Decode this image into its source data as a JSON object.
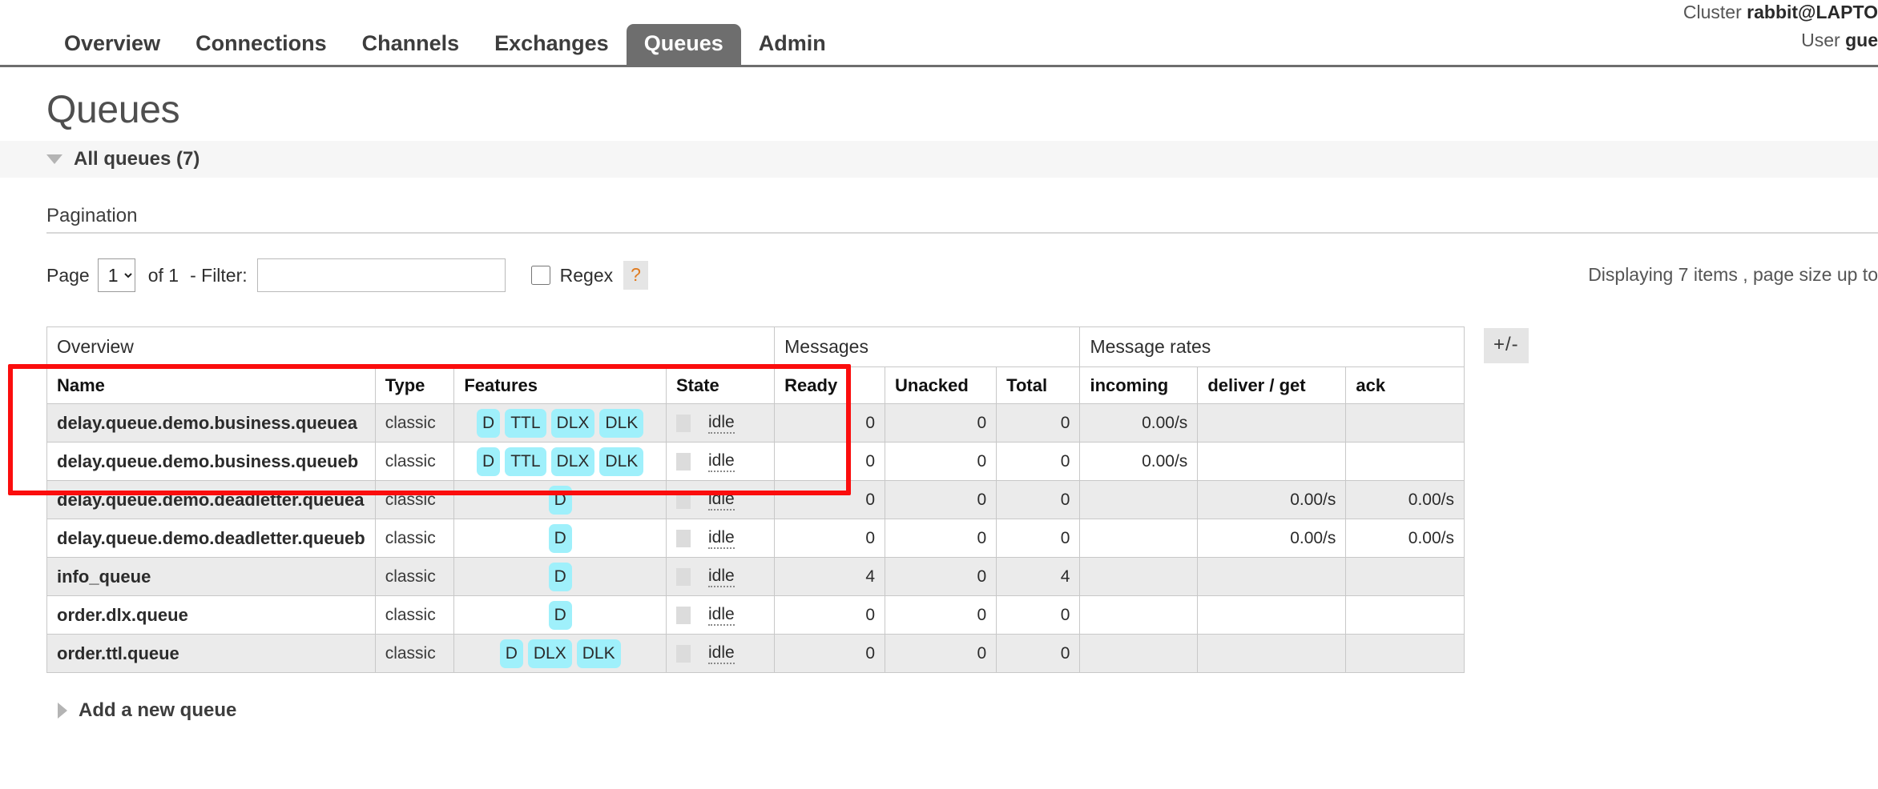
{
  "header": {
    "cluster_label": "Cluster",
    "cluster_name": "rabbit@LAPTO",
    "user_label": "User",
    "user_name": "gue",
    "nav": [
      {
        "label": "Overview",
        "active": false
      },
      {
        "label": "Connections",
        "active": false
      },
      {
        "label": "Channels",
        "active": false
      },
      {
        "label": "Exchanges",
        "active": false
      },
      {
        "label": "Queues",
        "active": true
      },
      {
        "label": "Admin",
        "active": false
      }
    ]
  },
  "page": {
    "title": "Queues",
    "section_label": "All queues (7)",
    "add_queue_label": "Add a new queue"
  },
  "pagination": {
    "heading": "Pagination",
    "page_word": "Page",
    "page_value": "1",
    "page_options": [
      "1"
    ],
    "of_text": "of 1",
    "filter_word": "- Filter:",
    "filter_value": "",
    "filter_placeholder": "",
    "regex_label": "Regex",
    "regex_checked": false,
    "help_badge": "?",
    "displaying_info": "Displaying 7 items , page size up to"
  },
  "table": {
    "group_headers": [
      {
        "label": "Overview",
        "span": 4
      },
      {
        "label": "Messages",
        "span": 3
      },
      {
        "label": "Message rates",
        "span": 3
      }
    ],
    "columns": [
      {
        "label": "Name",
        "key": "name"
      },
      {
        "label": "Type",
        "key": "type"
      },
      {
        "label": "Features",
        "key": "features"
      },
      {
        "label": "State",
        "key": "state"
      },
      {
        "label": "Ready",
        "key": "ready"
      },
      {
        "label": "Unacked",
        "key": "unacked"
      },
      {
        "label": "Total",
        "key": "total"
      },
      {
        "label": "incoming",
        "key": "incoming"
      },
      {
        "label": "deliver / get",
        "key": "deliver_get"
      },
      {
        "label": "ack",
        "key": "ack"
      }
    ],
    "plus_minus_label": "+/-",
    "rows": [
      {
        "name": "delay.queue.demo.business.queuea",
        "type": "classic",
        "features": [
          "D",
          "TTL",
          "DLX",
          "DLK"
        ],
        "state": "idle",
        "ready": "0",
        "unacked": "0",
        "total": "0",
        "incoming": "0.00/s",
        "deliver_get": "",
        "ack": ""
      },
      {
        "name": "delay.queue.demo.business.queueb",
        "type": "classic",
        "features": [
          "D",
          "TTL",
          "DLX",
          "DLK"
        ],
        "state": "idle",
        "ready": "0",
        "unacked": "0",
        "total": "0",
        "incoming": "0.00/s",
        "deliver_get": "",
        "ack": ""
      },
      {
        "name": "delay.queue.demo.deadletter.queuea",
        "type": "classic",
        "features": [
          "D"
        ],
        "state": "idle",
        "ready": "0",
        "unacked": "0",
        "total": "0",
        "incoming": "",
        "deliver_get": "0.00/s",
        "ack": "0.00/s"
      },
      {
        "name": "delay.queue.demo.deadletter.queueb",
        "type": "classic",
        "features": [
          "D"
        ],
        "state": "idle",
        "ready": "0",
        "unacked": "0",
        "total": "0",
        "incoming": "",
        "deliver_get": "0.00/s",
        "ack": "0.00/s"
      },
      {
        "name": "info_queue",
        "type": "classic",
        "features": [
          "D"
        ],
        "state": "idle",
        "ready": "4",
        "unacked": "0",
        "total": "4",
        "incoming": "",
        "deliver_get": "",
        "ack": ""
      },
      {
        "name": "order.dlx.queue",
        "type": "classic",
        "features": [
          "D"
        ],
        "state": "idle",
        "ready": "0",
        "unacked": "0",
        "total": "0",
        "incoming": "",
        "deliver_get": "",
        "ack": ""
      },
      {
        "name": "order.ttl.queue",
        "type": "classic",
        "features": [
          "D",
          "DLX",
          "DLK"
        ],
        "state": "idle",
        "ready": "0",
        "unacked": "0",
        "total": "0",
        "incoming": "",
        "deliver_get": "",
        "ack": ""
      }
    ]
  },
  "annotation": {
    "color": "#fb0d0d",
    "highlighted_rows": [
      0,
      1,
      2,
      3
    ]
  },
  "colors": {
    "feature_badge": "#9ff0fb",
    "active_tab": "#6e6e6e",
    "annotation_red": "#fb0d0d",
    "help_accent": "#e07b20"
  }
}
